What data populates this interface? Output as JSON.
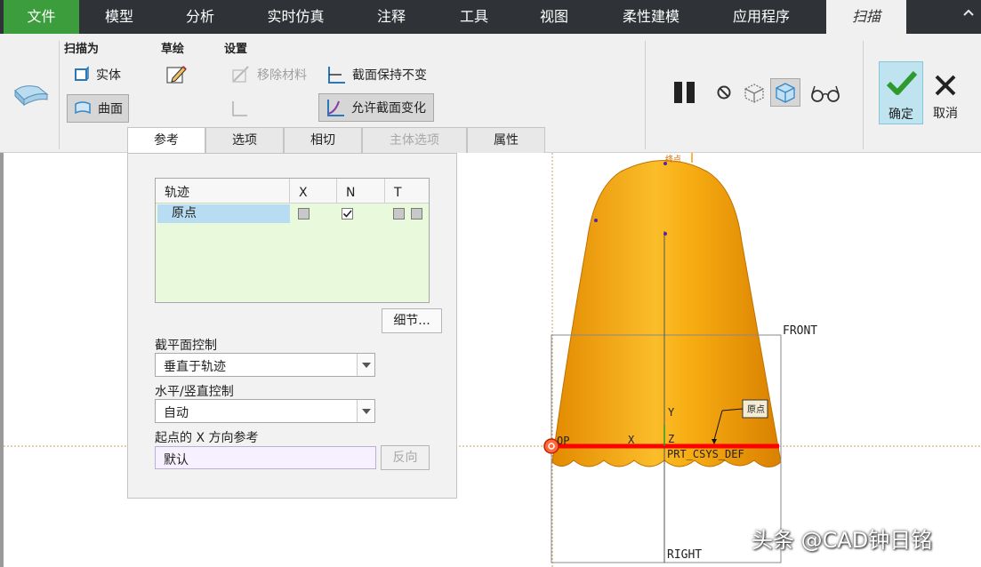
{
  "tabs": [
    {
      "label": "文件"
    },
    {
      "label": "模型"
    },
    {
      "label": "分析"
    },
    {
      "label": "实时仿真"
    },
    {
      "label": "注释"
    },
    {
      "label": "工具"
    },
    {
      "label": "视图"
    },
    {
      "label": "柔性建模"
    },
    {
      "label": "应用程序"
    },
    {
      "label": "扫描"
    }
  ],
  "ribbon": {
    "group_sweep_as": "扫描为",
    "solid_label": "实体",
    "surface_label": "曲面",
    "group_sketch": "草绘",
    "group_settings": "设置",
    "remove_material_label": "移除材料",
    "keep_section_label": "截面保持不变",
    "vary_section_label": "允许截面变化",
    "ok_label": "确定",
    "cancel_label": "取消"
  },
  "subtabs": [
    {
      "label": "参考"
    },
    {
      "label": "选项"
    },
    {
      "label": "相切"
    },
    {
      "label": "主体选项"
    },
    {
      "label": "属性"
    }
  ],
  "panel": {
    "table": {
      "headers": [
        "轨迹",
        "X",
        "N",
        "T"
      ],
      "rows": [
        {
          "name": "原点",
          "x": false,
          "n": true,
          "t": false
        }
      ]
    },
    "details_label": "细节...",
    "section_plane_label": "截平面控制",
    "section_plane_value": "垂直于轨迹",
    "hv_control_label": "水平/竖直控制",
    "hv_control_value": "自动",
    "x_ref_label": "起点的 X 方向参考",
    "x_ref_value": "默认",
    "flip_label": "反向"
  },
  "viewport": {
    "top_label": "终点",
    "front_label": "FRONT",
    "right_label": "RIGHT",
    "csys_label": "PRT_CSYS_DEF",
    "top_plane_label": "OP",
    "axis_x": "X",
    "axis_y": "Y",
    "axis_z": "Z",
    "callout_label": "原点",
    "model_color": "#f2a500",
    "trajectory_color": "#ff0000"
  },
  "watermark": "头条 @CAD钟日铭"
}
